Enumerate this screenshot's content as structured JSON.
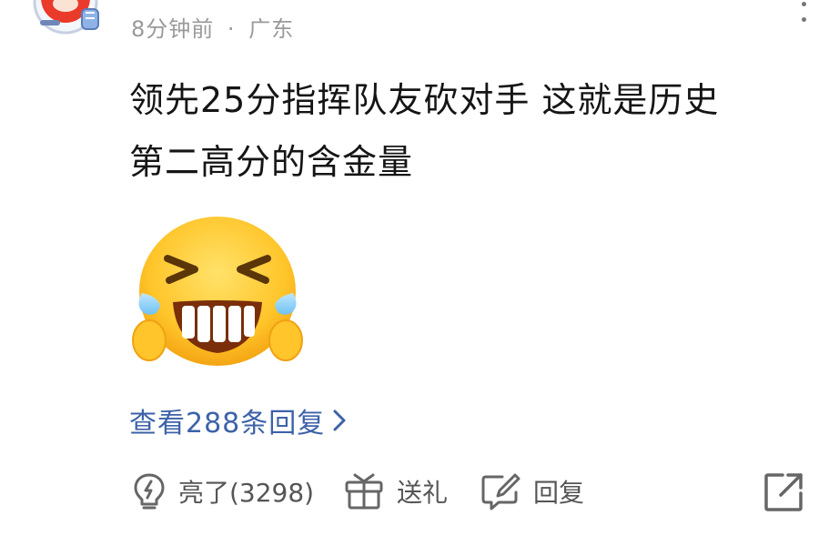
{
  "comment": {
    "time": "8分钟前",
    "separator": "·",
    "location": "广东",
    "content_lines": [
      "领先25分指挥队友砍对手 这就是历史",
      "第二高分的含金量"
    ]
  },
  "replies_link": {
    "label": "查看288条回复"
  },
  "actions": {
    "like_label": "亮了(3298)",
    "gift_label": "送礼",
    "reply_label": "回复"
  },
  "icons": {
    "avatar": "avatar-red-cartoon",
    "more": "more-vertical-icon",
    "like": "lightbulb-icon",
    "gift": "gift-icon",
    "reply": "edit-reply-icon",
    "share": "share-external-icon",
    "emoji": "laughing-tears-emoji"
  },
  "colors": {
    "link": "#3d62a8",
    "meta": "#9a9a9a",
    "text": "#151515",
    "icon": "#555555"
  }
}
